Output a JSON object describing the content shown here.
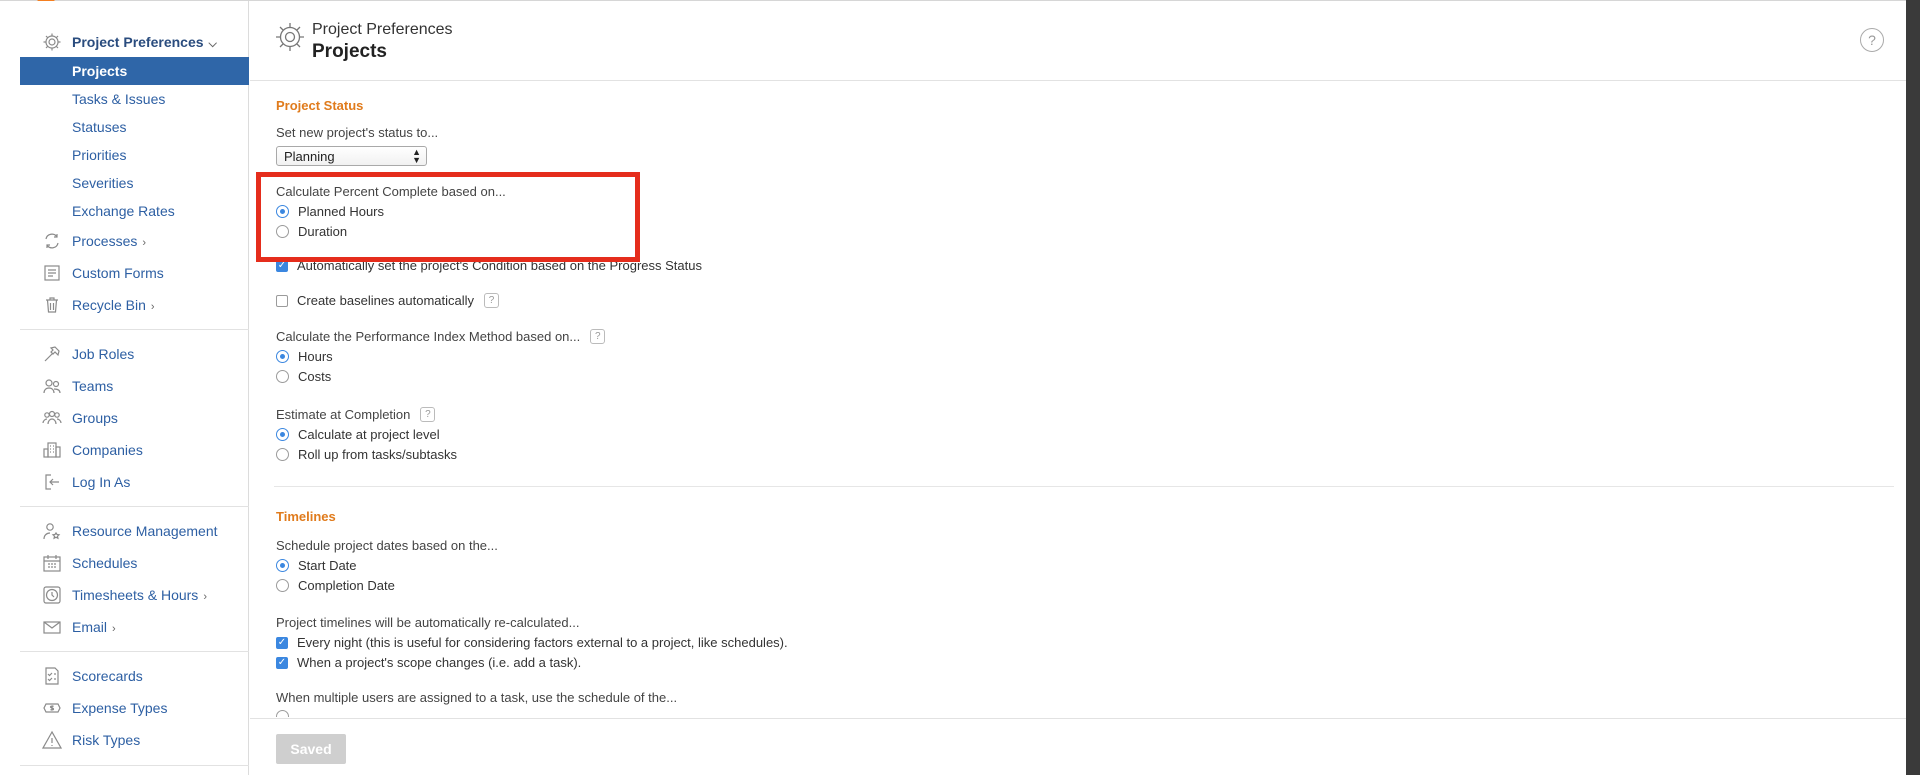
{
  "sidebar": {
    "section": "Project Preferences",
    "sub_items": [
      "Projects",
      "Tasks & Issues",
      "Statuses",
      "Priorities",
      "Severities",
      "Exchange Rates"
    ],
    "active": "Projects",
    "groups": [
      {
        "label": "Processes",
        "icon": "processes-icon",
        "chevron": "›"
      },
      {
        "label": "Custom Forms",
        "icon": "custom-forms-icon"
      },
      {
        "label": "Recycle Bin",
        "icon": "trash-icon",
        "chevron": "›"
      },
      {
        "label": "Job Roles",
        "icon": "hammer-icon"
      },
      {
        "label": "Teams",
        "icon": "teams-icon"
      },
      {
        "label": "Groups",
        "icon": "groups-icon"
      },
      {
        "label": "Companies",
        "icon": "building-icon"
      },
      {
        "label": "Log In As",
        "icon": "login-icon"
      },
      {
        "label": "Resource Management",
        "icon": "resource-icon"
      },
      {
        "label": "Schedules",
        "icon": "calendar-icon"
      },
      {
        "label": "Timesheets & Hours",
        "icon": "clock-icon",
        "chevron": "›"
      },
      {
        "label": "Email",
        "icon": "envelope-icon",
        "chevron": "›"
      },
      {
        "label": "Scorecards",
        "icon": "scorecard-icon"
      },
      {
        "label": "Expense Types",
        "icon": "money-icon"
      },
      {
        "label": "Risk Types",
        "icon": "warning-icon"
      }
    ],
    "chevron_down": "⌵"
  },
  "header": {
    "subtitle": "Project Preferences",
    "title": "Projects",
    "help": "?"
  },
  "project_status": {
    "title": "Project Status",
    "new_status_label": "Set new project's status to...",
    "new_status_value": "Planning",
    "percent_complete_label": "Calculate Percent Complete based on...",
    "percent_options": [
      "Planned Hours",
      "Duration"
    ],
    "percent_selected": "Planned Hours",
    "auto_condition_label": "Automatically set the project's Condition based on the Progress Status",
    "auto_condition_checked": true,
    "baselines_label": "Create baselines automatically",
    "baselines_checked": false,
    "perf_index_label": "Calculate the Performance Index Method based on...",
    "perf_options": [
      "Hours",
      "Costs"
    ],
    "perf_selected": "Hours",
    "eac_label": "Estimate at Completion",
    "eac_options": [
      "Calculate at project level",
      "Roll up from tasks/subtasks"
    ],
    "eac_selected": "Calculate at project level",
    "help_glyph": "?"
  },
  "timelines": {
    "title": "Timelines",
    "schedule_label": "Schedule project dates based on the...",
    "schedule_options": [
      "Start Date",
      "Completion Date"
    ],
    "schedule_selected": "Start Date",
    "recalc_label": "Project timelines will be automatically re-calculated...",
    "recalc_options": [
      "Every night (this is useful for considering factors external to a project, like schedules).",
      "When a project's scope changes (i.e. add a task)."
    ],
    "multi_user_label": "When multiple users are assigned to a task, use the schedule of the..."
  },
  "footer": {
    "saved_label": "Saved"
  },
  "colors": {
    "accent_orange": "#e07b1c",
    "active_blue": "#2f66a8",
    "link_blue": "#2d5fa3",
    "highlight_red": "#e52d1c",
    "control_blue": "#3b87e0"
  }
}
